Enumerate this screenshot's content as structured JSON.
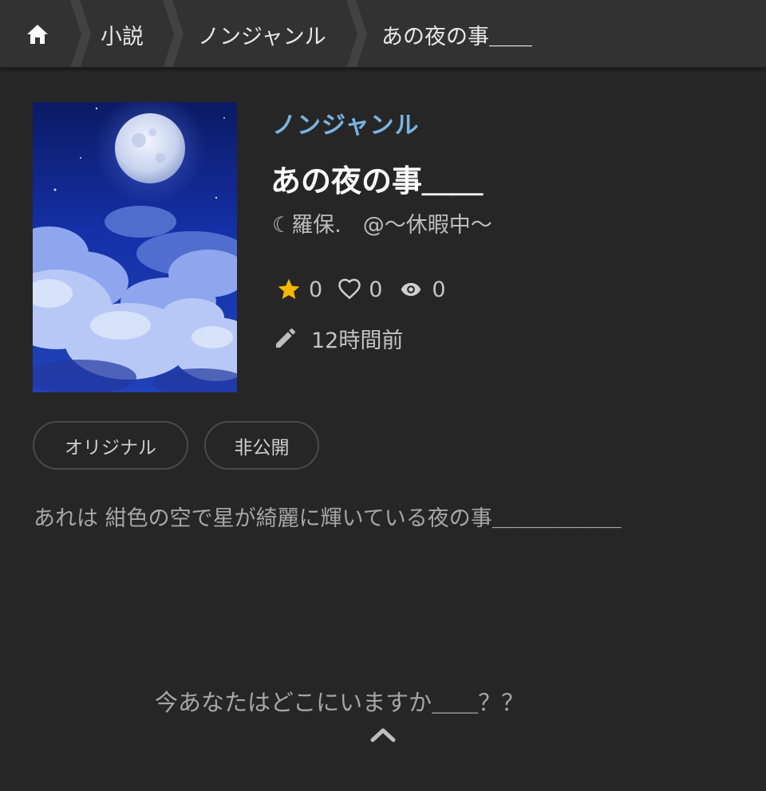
{
  "breadcrumb": {
    "home_icon": "home-icon",
    "items": [
      {
        "label": "小説"
      },
      {
        "label": "ノンジャンル"
      },
      {
        "label": "あの夜の事＿＿"
      }
    ]
  },
  "work": {
    "genre": "ノンジャンル",
    "title": "あの夜の事＿＿",
    "author": "☾羅保.　@〜休暇中〜",
    "cover_icon": "night-moon-cover",
    "stats": {
      "stars": "0",
      "likes": "0",
      "views": "0"
    },
    "updated": "12時間前",
    "tags": [
      "オリジナル",
      "非公開"
    ],
    "description": "あれは 紺色の空で星が綺麗に輝いている夜の事＿＿＿＿＿＿",
    "teaser": "今あなたはどこにいますか＿＿？？"
  },
  "colors": {
    "background": "#262626",
    "header": "#323232",
    "genre": "#7ab3e0",
    "star": "#f5b800"
  }
}
